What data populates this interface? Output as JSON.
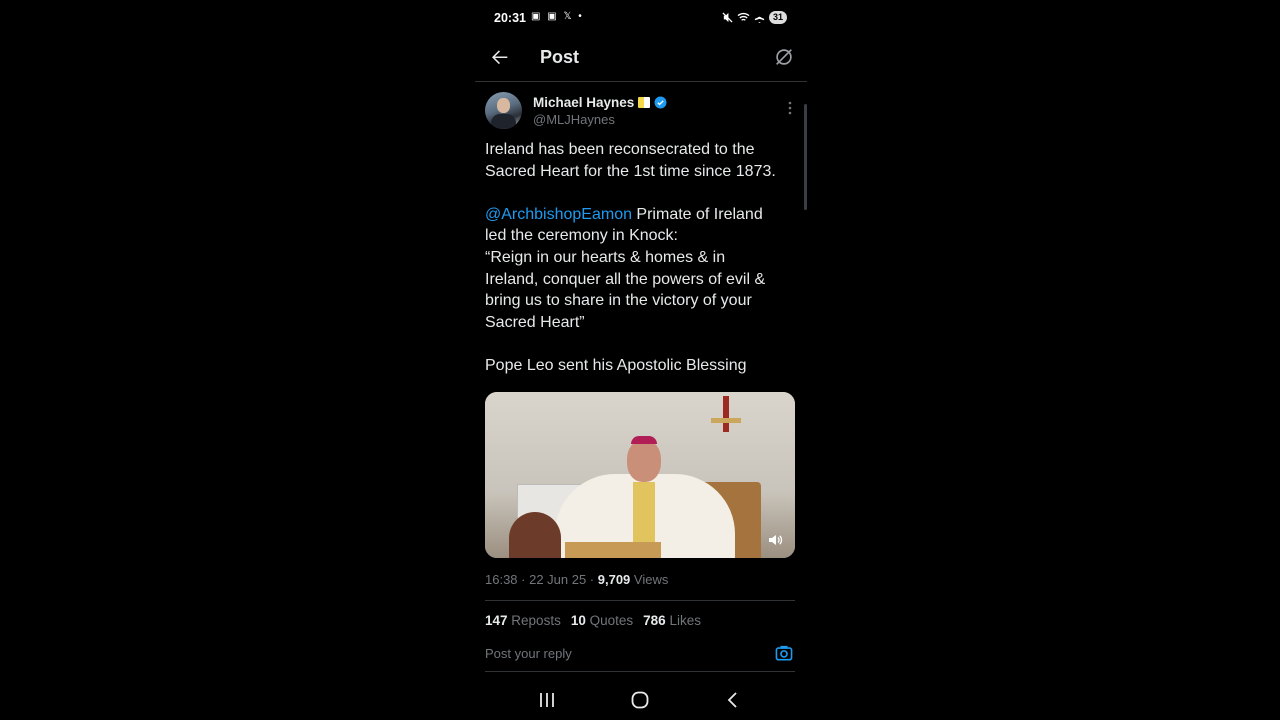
{
  "status_bar": {
    "time": "20:31",
    "left_icons": "▣ ▣ 𝕏 •",
    "battery": "31"
  },
  "header": {
    "title": "Post"
  },
  "post": {
    "author_name": "Michael Haynes",
    "handle": "@MLJHaynes",
    "text_line1": "Ireland has been reconsecrated to the\nSacred Heart for the 1st time since 1873.\n\n",
    "mention": "@ArchbishopEamon",
    "text_line2": " Primate of Ireland\nled the ceremony in Knock:\n“Reign in our hearts & homes & in\nIreland, conquer all the powers of evil &\nbring us to share in the victory of your\nSacred Heart”\n\nPope Leo sent his Apostolic Blessing",
    "timestamp": "16:38 · 22 Jun 25 · ",
    "views_count": "9,709",
    "views_label": " Views"
  },
  "stats": {
    "reposts_count": "147",
    "reposts_label": "Reposts",
    "quotes_count": "10",
    "quotes_label": "Quotes",
    "likes_count": "786",
    "likes_label": "Likes"
  },
  "reply": {
    "placeholder": "Post your reply"
  },
  "colors": {
    "accent": "#1d9bf0",
    "background": "#000000",
    "text": "#e7e9ea",
    "muted": "#71767b"
  }
}
